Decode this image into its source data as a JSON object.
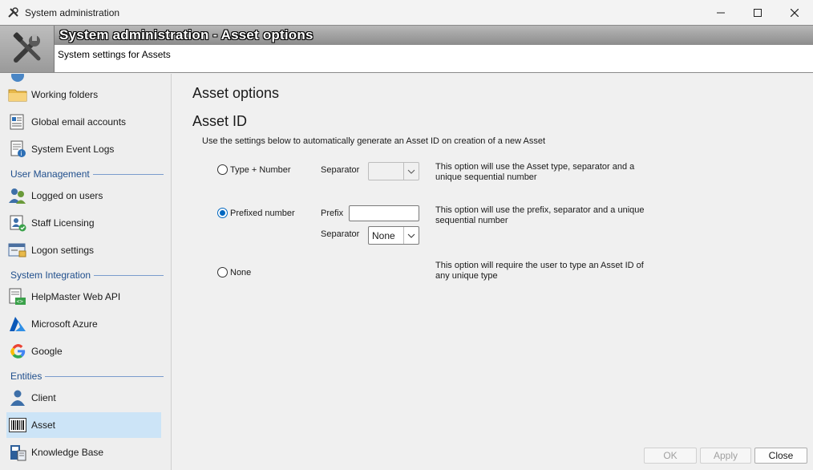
{
  "window": {
    "title": "System administration"
  },
  "banner": {
    "title": "System administration - Asset options",
    "subtitle": "System settings for Assets"
  },
  "sidebar": {
    "items_top": [
      {
        "label": "Working folders",
        "icon": "folder-icon"
      },
      {
        "label": "Global email accounts",
        "icon": "email-accounts-icon"
      },
      {
        "label": "System Event Logs",
        "icon": "event-log-icon"
      }
    ],
    "groups": [
      {
        "label": "User Management",
        "items": [
          {
            "label": "Logged on users",
            "icon": "logged-users-icon"
          },
          {
            "label": "Staff Licensing",
            "icon": "staff-licensing-icon"
          },
          {
            "label": "Logon settings",
            "icon": "logon-settings-icon"
          }
        ]
      },
      {
        "label": "System Integration",
        "items": [
          {
            "label": "HelpMaster Web API",
            "icon": "web-api-icon"
          },
          {
            "label": "Microsoft Azure",
            "icon": "azure-icon"
          },
          {
            "label": "Google",
            "icon": "google-icon"
          }
        ]
      },
      {
        "label": "Entities",
        "items": [
          {
            "label": "Client",
            "icon": "client-icon"
          },
          {
            "label": "Asset",
            "icon": "barcode-icon"
          },
          {
            "label": "Knowledge Base",
            "icon": "knowledge-base-icon"
          }
        ]
      }
    ],
    "selected": "Asset"
  },
  "main": {
    "heading": "Asset options",
    "section": "Asset ID",
    "description": "Use the settings below to automatically generate an Asset ID on creation of a new Asset",
    "options": [
      {
        "label": "Type + Number",
        "selected": false,
        "note": "This option will use the Asset type, separator and a unique sequential number",
        "separator_label": "Separator",
        "separator_value": ""
      },
      {
        "label": "Prefixed number",
        "selected": true,
        "note": "This option will use the prefix, separator and a unique sequential number",
        "prefix_label": "Prefix",
        "prefix_value": "",
        "separator_label": "Separator",
        "separator_value": "None"
      },
      {
        "label": "None",
        "selected": false,
        "note": "This option will require the user to type an Asset ID of any unique type"
      }
    ]
  },
  "footer": {
    "ok": "OK",
    "apply": "Apply",
    "close": "Close"
  },
  "colors": {
    "selection": "#cce4f7",
    "group_label": "#1f4e8c",
    "radio_accent": "#0067c0"
  }
}
